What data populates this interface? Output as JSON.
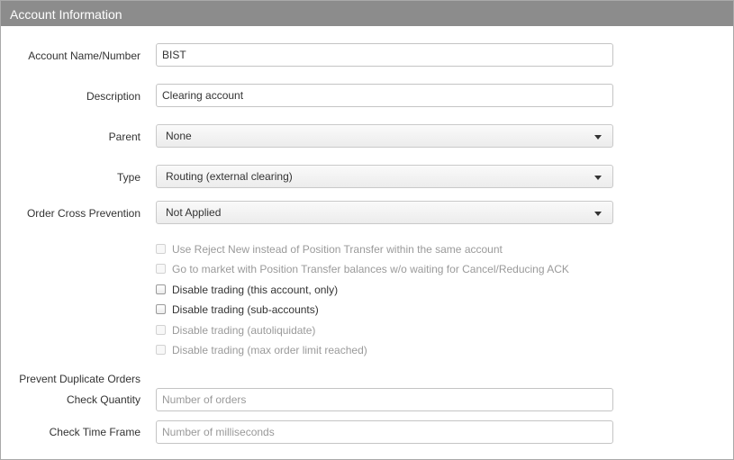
{
  "header": {
    "title": "Account Information"
  },
  "form": {
    "account_name": {
      "label": "Account Name/Number",
      "value": "BIST"
    },
    "description": {
      "label": "Description",
      "value": "Clearing account"
    },
    "parent": {
      "label": "Parent",
      "value": "None"
    },
    "type": {
      "label": "Type",
      "value": "Routing (external clearing)"
    },
    "order_cross": {
      "label": "Order Cross Prevention",
      "value": "Not Applied"
    },
    "checkboxes": [
      {
        "label": "Use Reject New instead of Position Transfer within the same account",
        "enabled": false,
        "checked": false
      },
      {
        "label": "Go to market with Position Transfer balances w/o waiting for Cancel/Reducing ACK",
        "enabled": false,
        "checked": false
      },
      {
        "label": "Disable trading (this account, only)",
        "enabled": true,
        "checked": false
      },
      {
        "label": "Disable trading (sub-accounts)",
        "enabled": true,
        "checked": false
      },
      {
        "label": "Disable trading (autoliquidate)",
        "enabled": false,
        "checked": false
      },
      {
        "label": "Disable trading (max order limit reached)",
        "enabled": false,
        "checked": false
      }
    ],
    "prevent_duplicate": {
      "heading": "Prevent Duplicate Orders"
    },
    "check_quantity": {
      "label": "Check Quantity",
      "placeholder": "Number of orders"
    },
    "check_time_frame": {
      "label": "Check Time Frame",
      "placeholder": "Number of milliseconds"
    }
  },
  "colors": {
    "header_bg": "#8c8c8c",
    "border": "#c4c4c4",
    "text": "#333333",
    "disabled_text": "#9a9a9a"
  }
}
